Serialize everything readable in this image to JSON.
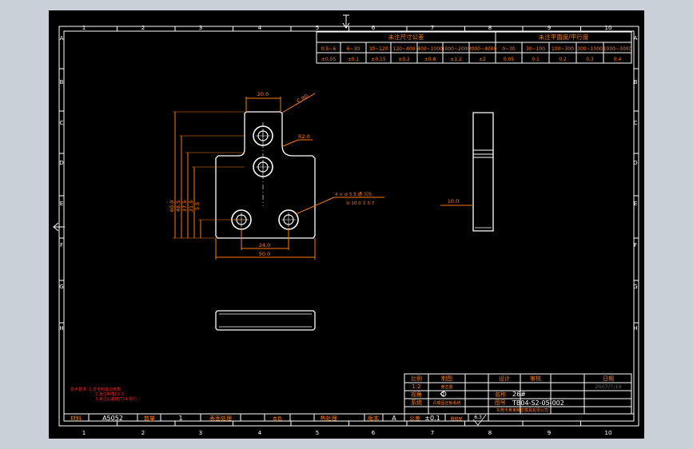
{
  "colors": {
    "background": "#000000",
    "window": "#c9d0d7",
    "frame": "#ffffff",
    "outline": "#ffffff",
    "dimension": "#ff7a00",
    "table_text": "#ff7a00",
    "note": "#ff2020",
    "center_line": "#ffffff",
    "date": "#5a5a5a"
  },
  "zones": {
    "columns": [
      "1",
      "2",
      "3",
      "4",
      "5",
      "6",
      "7",
      "8",
      "9",
      "10"
    ],
    "rows": [
      "A",
      "B",
      "C",
      "D",
      "E",
      "F",
      "G",
      "H"
    ]
  },
  "tolerance_table": {
    "size_title": "未注尺寸公差",
    "flatness_title": "未注平面度/平行度",
    "size_ranges": [
      "0.5~6",
      "6~30",
      "30~120",
      "120~400",
      "400~1000",
      "1000~2000",
      "2000~4000"
    ],
    "size_tolerances": [
      "±0.05",
      "±0.1",
      "±0.15",
      "±0.2",
      "±0.8",
      "±1.2",
      "±2"
    ],
    "flat_ranges": [
      "0~30",
      "30~100",
      "100~300",
      "300~1000",
      "1000~3000"
    ],
    "flat_tolerances": [
      "0.05",
      "0.1",
      "0.2",
      "0.3",
      "0.4"
    ]
  },
  "dimensions": {
    "top_width": "20.0",
    "chamfer": "C R0",
    "radius": "R2.0",
    "height_600": "60.0",
    "height_485": "48.5",
    "height_375": "37.5",
    "height_215": "21.5",
    "height_55": "5.5",
    "hole_spacing": "24.0",
    "base_width": "50.0",
    "thickness": "10.0",
    "hole_callout": "4 × ⊘ 5.5 通 沉头",
    "hole_callout_2": "⊘ 10.0 ↧ 5.7"
  },
  "notes": {
    "lines": [
      "技术要求: 1.去毛刺锐边倒角",
      "2.未注倒角C0.5",
      "3.未注公差按IT14 执行"
    ]
  },
  "title_block": {
    "scale_label": "比例",
    "scale_value": "1:2",
    "draw_label": "制图",
    "draw_value": "黄志勇",
    "design_label": "设计",
    "review_label": "审核",
    "date_label": "日期",
    "date_value": "2007/7/19",
    "projection_label": "视角",
    "name_label": "名称",
    "name_value": "26#",
    "system_label": "系统",
    "system_value": "凸模固定板系统",
    "drawing_label": "图号",
    "drawing_value": "TB04-S2-05-002",
    "material_label": "材料",
    "material_value": "A5052",
    "qty_label": "数量",
    "qty_value": "1",
    "surface_label": "表面处理",
    "surface_value": "本色",
    "heat_label": "热处理",
    "version_label": "版本",
    "version_value": "A",
    "tolerance_label": "公差",
    "tolerance_value": "±0.1",
    "roughness_label": "粗糙度",
    "roughness_value": "6.3",
    "company": "东莞市某某精密模具有限公司"
  }
}
